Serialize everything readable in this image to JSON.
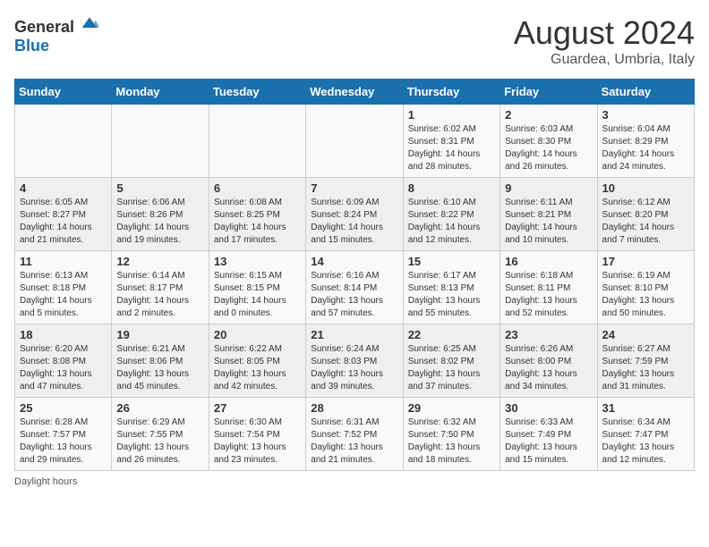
{
  "header": {
    "logo_general": "General",
    "logo_blue": "Blue",
    "title": "August 2024",
    "subtitle": "Guardea, Umbria, Italy"
  },
  "footer": {
    "note": "Daylight hours"
  },
  "days_of_week": [
    "Sunday",
    "Monday",
    "Tuesday",
    "Wednesday",
    "Thursday",
    "Friday",
    "Saturday"
  ],
  "weeks": [
    [
      {
        "day": "",
        "info": ""
      },
      {
        "day": "",
        "info": ""
      },
      {
        "day": "",
        "info": ""
      },
      {
        "day": "",
        "info": ""
      },
      {
        "day": "1",
        "info": "Sunrise: 6:02 AM\nSunset: 8:31 PM\nDaylight: 14 hours\nand 28 minutes."
      },
      {
        "day": "2",
        "info": "Sunrise: 6:03 AM\nSunset: 8:30 PM\nDaylight: 14 hours\nand 26 minutes."
      },
      {
        "day": "3",
        "info": "Sunrise: 6:04 AM\nSunset: 8:29 PM\nDaylight: 14 hours\nand 24 minutes."
      }
    ],
    [
      {
        "day": "4",
        "info": "Sunrise: 6:05 AM\nSunset: 8:27 PM\nDaylight: 14 hours\nand 21 minutes."
      },
      {
        "day": "5",
        "info": "Sunrise: 6:06 AM\nSunset: 8:26 PM\nDaylight: 14 hours\nand 19 minutes."
      },
      {
        "day": "6",
        "info": "Sunrise: 6:08 AM\nSunset: 8:25 PM\nDaylight: 14 hours\nand 17 minutes."
      },
      {
        "day": "7",
        "info": "Sunrise: 6:09 AM\nSunset: 8:24 PM\nDaylight: 14 hours\nand 15 minutes."
      },
      {
        "day": "8",
        "info": "Sunrise: 6:10 AM\nSunset: 8:22 PM\nDaylight: 14 hours\nand 12 minutes."
      },
      {
        "day": "9",
        "info": "Sunrise: 6:11 AM\nSunset: 8:21 PM\nDaylight: 14 hours\nand 10 minutes."
      },
      {
        "day": "10",
        "info": "Sunrise: 6:12 AM\nSunset: 8:20 PM\nDaylight: 14 hours\nand 7 minutes."
      }
    ],
    [
      {
        "day": "11",
        "info": "Sunrise: 6:13 AM\nSunset: 8:18 PM\nDaylight: 14 hours\nand 5 minutes."
      },
      {
        "day": "12",
        "info": "Sunrise: 6:14 AM\nSunset: 8:17 PM\nDaylight: 14 hours\nand 2 minutes."
      },
      {
        "day": "13",
        "info": "Sunrise: 6:15 AM\nSunset: 8:15 PM\nDaylight: 14 hours\nand 0 minutes."
      },
      {
        "day": "14",
        "info": "Sunrise: 6:16 AM\nSunset: 8:14 PM\nDaylight: 13 hours\nand 57 minutes."
      },
      {
        "day": "15",
        "info": "Sunrise: 6:17 AM\nSunset: 8:13 PM\nDaylight: 13 hours\nand 55 minutes."
      },
      {
        "day": "16",
        "info": "Sunrise: 6:18 AM\nSunset: 8:11 PM\nDaylight: 13 hours\nand 52 minutes."
      },
      {
        "day": "17",
        "info": "Sunrise: 6:19 AM\nSunset: 8:10 PM\nDaylight: 13 hours\nand 50 minutes."
      }
    ],
    [
      {
        "day": "18",
        "info": "Sunrise: 6:20 AM\nSunset: 8:08 PM\nDaylight: 13 hours\nand 47 minutes."
      },
      {
        "day": "19",
        "info": "Sunrise: 6:21 AM\nSunset: 8:06 PM\nDaylight: 13 hours\nand 45 minutes."
      },
      {
        "day": "20",
        "info": "Sunrise: 6:22 AM\nSunset: 8:05 PM\nDaylight: 13 hours\nand 42 minutes."
      },
      {
        "day": "21",
        "info": "Sunrise: 6:24 AM\nSunset: 8:03 PM\nDaylight: 13 hours\nand 39 minutes."
      },
      {
        "day": "22",
        "info": "Sunrise: 6:25 AM\nSunset: 8:02 PM\nDaylight: 13 hours\nand 37 minutes."
      },
      {
        "day": "23",
        "info": "Sunrise: 6:26 AM\nSunset: 8:00 PM\nDaylight: 13 hours\nand 34 minutes."
      },
      {
        "day": "24",
        "info": "Sunrise: 6:27 AM\nSunset: 7:59 PM\nDaylight: 13 hours\nand 31 minutes."
      }
    ],
    [
      {
        "day": "25",
        "info": "Sunrise: 6:28 AM\nSunset: 7:57 PM\nDaylight: 13 hours\nand 29 minutes."
      },
      {
        "day": "26",
        "info": "Sunrise: 6:29 AM\nSunset: 7:55 PM\nDaylight: 13 hours\nand 26 minutes."
      },
      {
        "day": "27",
        "info": "Sunrise: 6:30 AM\nSunset: 7:54 PM\nDaylight: 13 hours\nand 23 minutes."
      },
      {
        "day": "28",
        "info": "Sunrise: 6:31 AM\nSunset: 7:52 PM\nDaylight: 13 hours\nand 21 minutes."
      },
      {
        "day": "29",
        "info": "Sunrise: 6:32 AM\nSunset: 7:50 PM\nDaylight: 13 hours\nand 18 minutes."
      },
      {
        "day": "30",
        "info": "Sunrise: 6:33 AM\nSunset: 7:49 PM\nDaylight: 13 hours\nand 15 minutes."
      },
      {
        "day": "31",
        "info": "Sunrise: 6:34 AM\nSunset: 7:47 PM\nDaylight: 13 hours\nand 12 minutes."
      }
    ]
  ]
}
